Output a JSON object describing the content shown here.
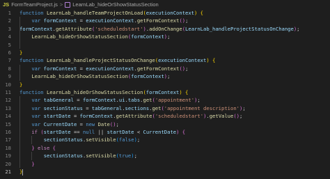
{
  "breadcrumb": {
    "lang_badge": "JS",
    "file": "FormTeamProject.js",
    "separator": ">",
    "symbol": "LearnLab_hideOrShowStatusSection"
  },
  "editor": {
    "lines": [
      {
        "n": "1",
        "indent": 0,
        "tokens": [
          [
            "function ",
            "k"
          ],
          [
            "LearnLab_handleTeamProjectOnLoad",
            "f"
          ],
          [
            "(",
            "b1"
          ],
          [
            "executionContext",
            "v"
          ],
          [
            ")",
            "b1"
          ],
          [
            " {",
            "b1"
          ]
        ]
      },
      {
        "n": "2",
        "indent": 1,
        "tokens": [
          [
            "var ",
            "k"
          ],
          [
            "formContext",
            "v"
          ],
          [
            " = ",
            "o"
          ],
          [
            "executionContext",
            "v"
          ],
          [
            ".",
            "o"
          ],
          [
            "getFormContext",
            "f"
          ],
          [
            "()",
            "b2"
          ],
          [
            ";",
            "o"
          ]
        ]
      },
      {
        "n": "3",
        "indent": 0,
        "tokens": [
          [
            "formContext",
            "v"
          ],
          [
            ".",
            "o"
          ],
          [
            "getAttribute",
            "f"
          ],
          [
            "(",
            "b2"
          ],
          [
            "'scheduledstart'",
            "s"
          ],
          [
            ")",
            "b2"
          ],
          [
            ".",
            "o"
          ],
          [
            "addOnChange",
            "f"
          ],
          [
            "(",
            "b2"
          ],
          [
            "LearnLab_handleProjectStatusOnChange",
            "v"
          ],
          [
            ")",
            "b2"
          ],
          [
            ";",
            "o"
          ]
        ]
      },
      {
        "n": "4",
        "indent": 1,
        "tokens": [
          [
            "LearnLab_hideOrShowStatusSection",
            "f"
          ],
          [
            "(",
            "b2"
          ],
          [
            "formContext",
            "v"
          ],
          [
            ")",
            "b2"
          ],
          [
            ";",
            "o"
          ]
        ]
      },
      {
        "n": "5",
        "indent": 0,
        "tokens": []
      },
      {
        "n": "6",
        "indent": 0,
        "tokens": [
          [
            "}",
            "b1"
          ]
        ]
      },
      {
        "n": "7",
        "indent": 0,
        "tokens": [
          [
            "function ",
            "k"
          ],
          [
            "LearnLab_handleProjectStatusOnChange",
            "f"
          ],
          [
            "(",
            "b1"
          ],
          [
            "executionContext",
            "v"
          ],
          [
            ")",
            "b1"
          ],
          [
            " {",
            "b1"
          ]
        ]
      },
      {
        "n": "8",
        "indent": 1,
        "tokens": [
          [
            "var ",
            "k"
          ],
          [
            "formContext",
            "v"
          ],
          [
            " = ",
            "o"
          ],
          [
            "executionContext",
            "v"
          ],
          [
            ".",
            "o"
          ],
          [
            "getFormContext",
            "f"
          ],
          [
            "()",
            "b2"
          ],
          [
            ";",
            "o"
          ]
        ]
      },
      {
        "n": "9",
        "indent": 1,
        "tokens": [
          [
            "LearnLab_hideOrShowStatusSection",
            "f"
          ],
          [
            "(",
            "b2"
          ],
          [
            "formContext",
            "v"
          ],
          [
            ")",
            "b2"
          ],
          [
            ";",
            "o"
          ]
        ]
      },
      {
        "n": "10",
        "indent": 0,
        "tokens": [
          [
            "}",
            "b1"
          ]
        ]
      },
      {
        "n": "11",
        "indent": 0,
        "tokens": [
          [
            "function ",
            "k"
          ],
          [
            "LearnLab_hideOrShowStatusSection",
            "f"
          ],
          [
            "(",
            "b1"
          ],
          [
            "formContext",
            "v"
          ],
          [
            ")",
            "b1"
          ],
          [
            " {",
            "b1"
          ]
        ]
      },
      {
        "n": "12",
        "indent": 1,
        "tokens": [
          [
            "var ",
            "k"
          ],
          [
            "tabGeneral",
            "v"
          ],
          [
            " = ",
            "o"
          ],
          [
            "formContext",
            "v"
          ],
          [
            ".",
            "o"
          ],
          [
            "ui",
            "v"
          ],
          [
            ".",
            "o"
          ],
          [
            "tabs",
            "v"
          ],
          [
            ".",
            "o"
          ],
          [
            "get",
            "f"
          ],
          [
            "(",
            "b2"
          ],
          [
            "'appointment'",
            "s"
          ],
          [
            ")",
            "b2"
          ],
          [
            ";",
            "o"
          ]
        ]
      },
      {
        "n": "13",
        "indent": 1,
        "tokens": [
          [
            "var ",
            "k"
          ],
          [
            "sectionStatus",
            "v"
          ],
          [
            " = ",
            "o"
          ],
          [
            "tabGeneral",
            "v"
          ],
          [
            ".",
            "o"
          ],
          [
            "sections",
            "v"
          ],
          [
            ".",
            "o"
          ],
          [
            "get",
            "f"
          ],
          [
            "(",
            "b2"
          ],
          [
            "'appointment description'",
            "s"
          ],
          [
            ")",
            "b2"
          ],
          [
            ";",
            "o"
          ]
        ]
      },
      {
        "n": "14",
        "indent": 1,
        "tokens": [
          [
            "var ",
            "k"
          ],
          [
            "startDate",
            "v"
          ],
          [
            " = ",
            "o"
          ],
          [
            "formContext",
            "v"
          ],
          [
            ".",
            "o"
          ],
          [
            "getAttribute",
            "f"
          ],
          [
            "(",
            "b2"
          ],
          [
            "'scheduledstart'",
            "s"
          ],
          [
            ")",
            "b2"
          ],
          [
            ".",
            "o"
          ],
          [
            "getValue",
            "f"
          ],
          [
            "()",
            "b2"
          ],
          [
            ";",
            "o"
          ]
        ]
      },
      {
        "n": "15",
        "indent": 1,
        "tokens": [
          [
            "var ",
            "k"
          ],
          [
            "CurrentDate",
            "v"
          ],
          [
            " = ",
            "o"
          ],
          [
            "new ",
            "k"
          ],
          [
            "Date",
            "f"
          ],
          [
            "()",
            "b2"
          ],
          [
            ";",
            "o"
          ]
        ]
      },
      {
        "n": "16",
        "indent": 1,
        "tokens": [
          [
            "if ",
            "c"
          ],
          [
            "(",
            "b2"
          ],
          [
            "startDate",
            "v"
          ],
          [
            " == ",
            "o"
          ],
          [
            "null",
            "k"
          ],
          [
            " || ",
            "o"
          ],
          [
            "startDate",
            "v"
          ],
          [
            " < ",
            "o"
          ],
          [
            "CurrentDate",
            "v"
          ],
          [
            ")",
            "b2"
          ],
          [
            " {",
            "b2"
          ]
        ]
      },
      {
        "n": "17",
        "indent": 2,
        "tokens": [
          [
            "sectionStatus",
            "v"
          ],
          [
            ".",
            "o"
          ],
          [
            "setVisible",
            "f"
          ],
          [
            "(",
            "b3"
          ],
          [
            "false",
            "k"
          ],
          [
            ")",
            "b3"
          ],
          [
            ";",
            "o"
          ]
        ]
      },
      {
        "n": "18",
        "indent": 1,
        "tokens": [
          [
            "}",
            "b2"
          ],
          [
            " else ",
            "c"
          ],
          [
            "{",
            "b2"
          ]
        ]
      },
      {
        "n": "19",
        "indent": 2,
        "tokens": [
          [
            "sectionStatus",
            "v"
          ],
          [
            ".",
            "o"
          ],
          [
            "setVisible",
            "f"
          ],
          [
            "(",
            "b3"
          ],
          [
            "true",
            "k"
          ],
          [
            ")",
            "b3"
          ],
          [
            ";",
            "o"
          ]
        ]
      },
      {
        "n": "20",
        "indent": 1,
        "tokens": [
          [
            "}",
            "b2"
          ]
        ]
      },
      {
        "n": "21",
        "indent": 0,
        "tokens": [
          [
            "}",
            "b1"
          ]
        ]
      }
    ],
    "current_line": "21"
  }
}
